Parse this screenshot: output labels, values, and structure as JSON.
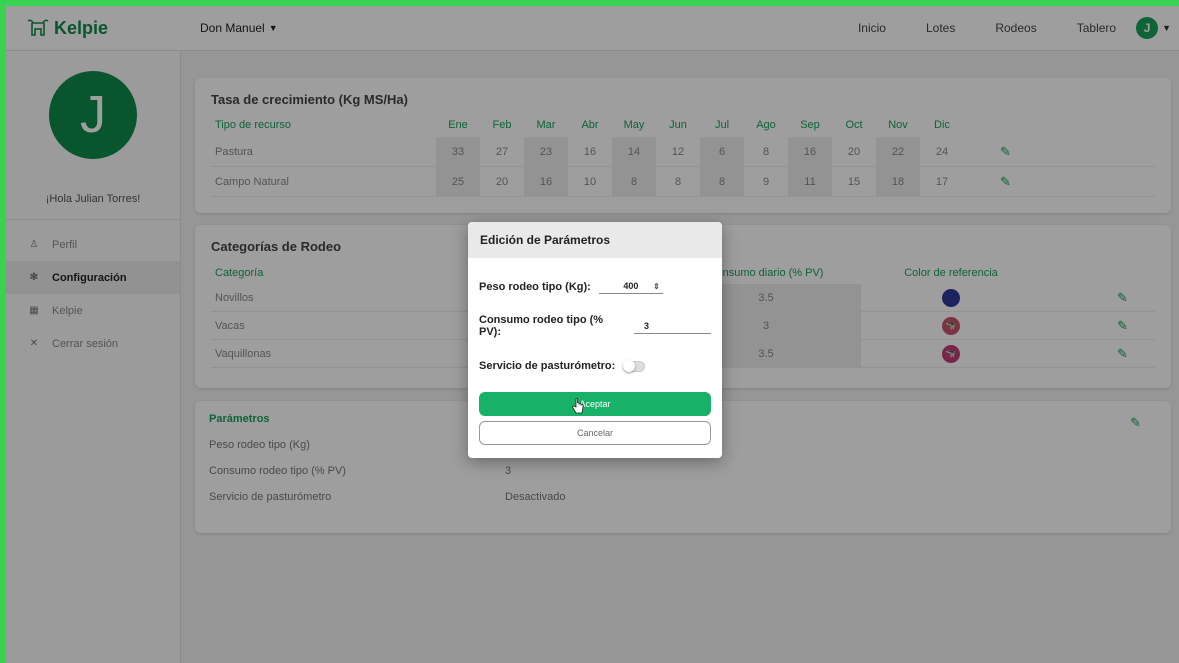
{
  "brand": {
    "name": "Kelpie",
    "logo_icon": "cow-icon"
  },
  "header": {
    "ranch": "Don Manuel",
    "nav": [
      "Inicio",
      "Lotes",
      "Rodeos",
      "Tablero"
    ],
    "avatar_initial": "J"
  },
  "sidebar": {
    "avatar_initial": "J",
    "greeting": "¡Hola Julian Torres!",
    "items": [
      {
        "label": "Perfil",
        "icon": "user-icon"
      },
      {
        "label": "Configuración",
        "icon": "gear-icon"
      },
      {
        "label": "Kelpie",
        "icon": "table-icon"
      },
      {
        "label": "Cerrar sesión",
        "icon": "close-icon"
      }
    ]
  },
  "growth": {
    "title": "Tasa de crecimiento (Kg MS/Ha)",
    "col_label": "Tipo de recurso",
    "months": [
      "Ene",
      "Feb",
      "Mar",
      "Abr",
      "May",
      "Jun",
      "Jul",
      "Ago",
      "Sep",
      "Oct",
      "Nov",
      "Dic"
    ],
    "rows": [
      {
        "name": "Pastura",
        "values": [
          "33",
          "27",
          "23",
          "16",
          "14",
          "12",
          "6",
          "8",
          "16",
          "20",
          "22",
          "24"
        ]
      },
      {
        "name": "Campo Natural",
        "values": [
          "25",
          "20",
          "16",
          "10",
          "8",
          "8",
          "8",
          "9",
          "11",
          "15",
          "18",
          "17"
        ]
      }
    ]
  },
  "categories": {
    "title": "Categorías de Rodeo",
    "col_category": "Categoría",
    "col_consumption": "Consumo diario (% PV)",
    "col_color": "Color de referencia",
    "rows": [
      {
        "name": "Novillos",
        "consumption": "3.5",
        "color": "#2d3a9c"
      },
      {
        "name": "Vacas",
        "consumption": "3",
        "color": "#c9556a"
      },
      {
        "name": "Vaquillonas",
        "consumption": "3.5",
        "color": "#c43a7a"
      }
    ]
  },
  "params": {
    "title": "Parámetros",
    "rows": [
      {
        "label": "Peso rodeo tipo (Kg)",
        "value": ""
      },
      {
        "label": "Consumo rodeo tipo (% PV)",
        "value": "3"
      },
      {
        "label": "Servicio de pasturómetro",
        "value": "Desactivado"
      }
    ]
  },
  "modal": {
    "title": "Edición de Parámetros",
    "weight_label": "Peso rodeo tipo (Kg):",
    "weight_value": "400",
    "consumption_label": "Consumo rodeo tipo (% PV):",
    "consumption_value": "3",
    "service_label": "Servicio de pasturómetro:",
    "service_on": false,
    "accept": "Aceptar",
    "cancel": "Cancelar"
  },
  "colors": {
    "accent": "#17a05a",
    "brand": "#0f8a4a",
    "button": "#17b267"
  }
}
